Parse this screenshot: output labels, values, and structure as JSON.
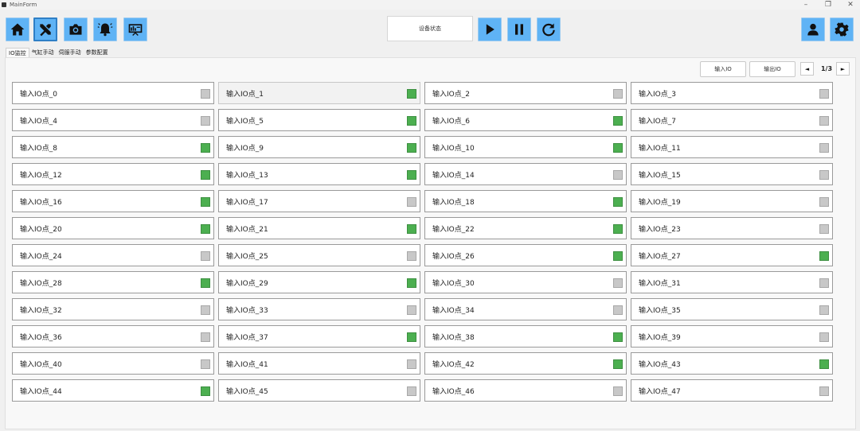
{
  "window": {
    "title": "MainForm"
  },
  "toolbar": {
    "left_buttons": [
      {
        "name": "home-button",
        "icon": "home-icon"
      },
      {
        "name": "tools-button",
        "icon": "tools-icon"
      },
      {
        "name": "camera-button",
        "icon": "camera-icon"
      },
      {
        "name": "alarm-button",
        "icon": "bell-icon"
      },
      {
        "name": "monitor-button",
        "icon": "monitor-icon"
      }
    ],
    "status_label": "设备状态",
    "right_buttons": [
      {
        "name": "user-button",
        "icon": "user-icon"
      },
      {
        "name": "settings-button",
        "icon": "gear-icon"
      }
    ]
  },
  "tabs": [
    "IO监控",
    "气缸手动",
    "伺服手动",
    "参数配置"
  ],
  "io_panel": {
    "input_button": "输入IO",
    "output_button": "输出IO",
    "prev": "◄",
    "next": "►",
    "page": "1/3",
    "on_color": "#4caf50",
    "off_color": "#c8c8c8",
    "points": [
      {
        "label": "输入IO点_0",
        "on": false
      },
      {
        "label": "输入IO点_1",
        "on": true
      },
      {
        "label": "输入IO点_2",
        "on": false
      },
      {
        "label": "输入IO点_3",
        "on": false
      },
      {
        "label": "输入IO点_4",
        "on": false
      },
      {
        "label": "输入IO点_5",
        "on": true
      },
      {
        "label": "输入IO点_6",
        "on": true
      },
      {
        "label": "输入IO点_7",
        "on": false
      },
      {
        "label": "输入IO点_8",
        "on": true
      },
      {
        "label": "输入IO点_9",
        "on": true
      },
      {
        "label": "输入IO点_10",
        "on": true
      },
      {
        "label": "输入IO点_11",
        "on": false
      },
      {
        "label": "输入IO点_12",
        "on": true
      },
      {
        "label": "输入IO点_13",
        "on": true
      },
      {
        "label": "输入IO点_14",
        "on": false
      },
      {
        "label": "输入IO点_15",
        "on": false
      },
      {
        "label": "输入IO点_16",
        "on": true
      },
      {
        "label": "输入IO点_17",
        "on": false
      },
      {
        "label": "输入IO点_18",
        "on": true
      },
      {
        "label": "输入IO点_19",
        "on": false
      },
      {
        "label": "输入IO点_20",
        "on": true
      },
      {
        "label": "输入IO点_21",
        "on": true
      },
      {
        "label": "输入IO点_22",
        "on": true
      },
      {
        "label": "输入IO点_23",
        "on": false
      },
      {
        "label": "输入IO点_24",
        "on": false
      },
      {
        "label": "输入IO点_25",
        "on": false
      },
      {
        "label": "输入IO点_26",
        "on": true
      },
      {
        "label": "输入IO点_27",
        "on": true
      },
      {
        "label": "输入IO点_28",
        "on": true
      },
      {
        "label": "输入IO点_29",
        "on": true
      },
      {
        "label": "输入IO点_30",
        "on": false
      },
      {
        "label": "输入IO点_31",
        "on": false
      },
      {
        "label": "输入IO点_32",
        "on": false
      },
      {
        "label": "输入IO点_33",
        "on": false
      },
      {
        "label": "输入IO点_34",
        "on": false
      },
      {
        "label": "输入IO点_35",
        "on": false
      },
      {
        "label": "输入IO点_36",
        "on": false
      },
      {
        "label": "输入IO点_37",
        "on": true
      },
      {
        "label": "输入IO点_38",
        "on": true
      },
      {
        "label": "输入IO点_39",
        "on": false
      },
      {
        "label": "输入IO点_40",
        "on": false
      },
      {
        "label": "输入IO点_41",
        "on": false
      },
      {
        "label": "输入IO点_42",
        "on": true
      },
      {
        "label": "输入IO点_43",
        "on": true
      },
      {
        "label": "输入IO点_44",
        "on": true
      },
      {
        "label": "输入IO点_45",
        "on": false
      },
      {
        "label": "输入IO点_46",
        "on": false
      },
      {
        "label": "输入IO点_47",
        "on": false
      }
    ]
  }
}
